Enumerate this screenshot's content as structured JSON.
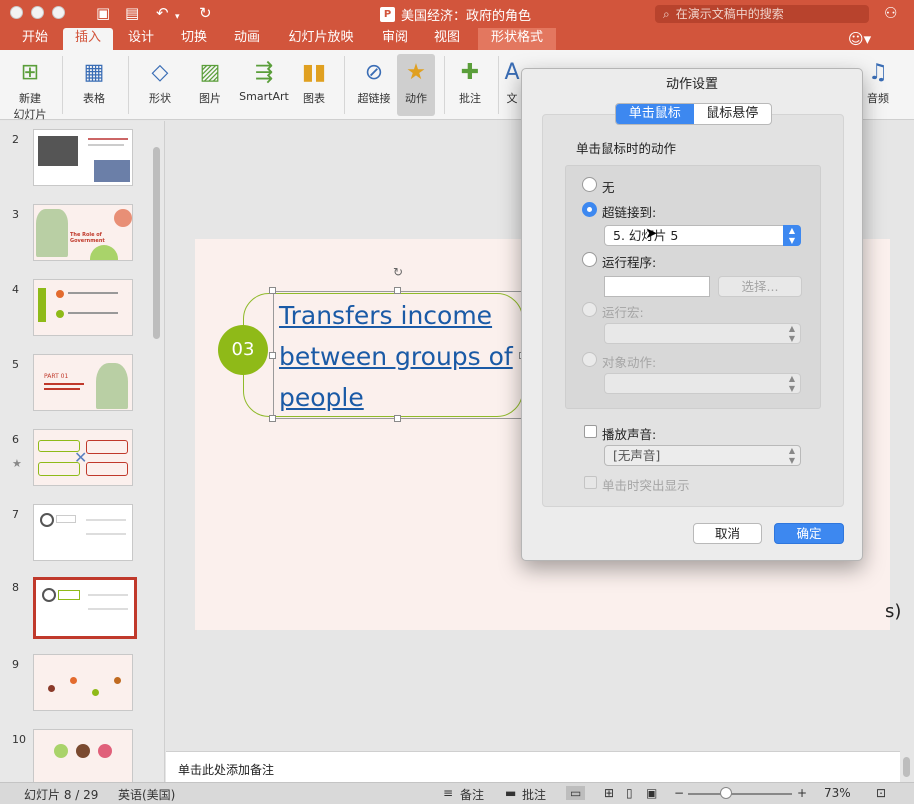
{
  "window": {
    "title": "美国经济：政府的角色",
    "search_placeholder": "在演示文稿中的搜索"
  },
  "tabs": [
    "开始",
    "插入",
    "设计",
    "切换",
    "动画",
    "幻灯片放映",
    "审阅",
    "视图",
    "形状格式"
  ],
  "active_tab": "插入",
  "ribbon": {
    "new_slide_line1": "新建",
    "new_slide_line2": "幻灯片",
    "table": "表格",
    "shapes": "形状",
    "pictures": "图片",
    "smartart": "SmartArt",
    "chart": "图表",
    "hyperlink": "超链接",
    "action": "动作",
    "comment": "批注",
    "text_partial": "文",
    "audio": "音频"
  },
  "slides_panel": {
    "thumbnails": [
      {
        "num": "2"
      },
      {
        "num": "3",
        "text": "The Role of Government"
      },
      {
        "num": "4"
      },
      {
        "num": "5",
        "text": "PART 01"
      },
      {
        "num": "6",
        "starred": true
      },
      {
        "num": "7"
      },
      {
        "num": "8",
        "selected": true
      },
      {
        "num": "9"
      },
      {
        "num": "10"
      }
    ]
  },
  "slide": {
    "badge": "03",
    "hyperlink_line1": "Transfers income",
    "hyperlink_line2": "between groups of",
    "hyperlink_line3": "people",
    "right_fragment": "s)"
  },
  "notes_placeholder": "单击此处添加备注",
  "status": {
    "slide_indicator": "幻灯片 8 / 29",
    "language": "英语(美国)",
    "notes": "备注",
    "comments": "批注",
    "zoom": "73%"
  },
  "dialog": {
    "title": "动作设置",
    "tab_click": "单击鼠标",
    "tab_hover": "鼠标悬停",
    "heading": "单击鼠标时的动作",
    "opt_none": "无",
    "opt_hyperlink": "超链接到:",
    "hyperlink_value": "5. 幻灯片 5",
    "opt_run_program": "运行程序:",
    "browse": "选择...",
    "opt_run_macro": "运行宏:",
    "opt_object_action": "对象动作:",
    "play_sound": "播放声音:",
    "sound_value": "[无声音]",
    "highlight_click": "单击时突出显示",
    "cancel": "取消",
    "ok": "确定"
  },
  "colors": {
    "accent": "#d2553c",
    "hyperlink": "#1a5aa6",
    "badge": "#8fba18",
    "primary_button": "#3d88f0"
  }
}
